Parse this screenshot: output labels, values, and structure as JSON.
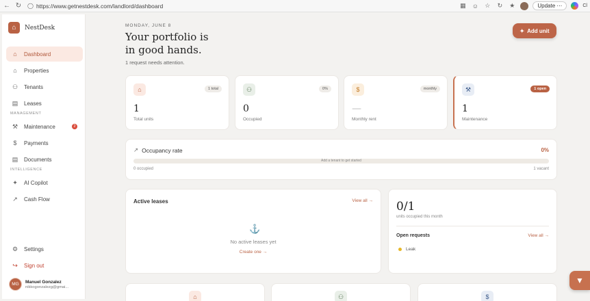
{
  "browser": {
    "url": "https://www.getnestdesk.com/landlord/dashboard",
    "update_label": "Update",
    "more_label": "⋯",
    "copilot_label": "Cl"
  },
  "sidebar": {
    "brand": "NestDesk",
    "items": [
      {
        "label": "Dashboard",
        "icon": "home-icon"
      },
      {
        "label": "Properties",
        "icon": "building-icon"
      },
      {
        "label": "Tenants",
        "icon": "users-icon"
      },
      {
        "label": "Leases",
        "icon": "document-icon"
      }
    ],
    "section_management": "MANAGEMENT",
    "management_items": [
      {
        "label": "Maintenance",
        "icon": "wrench-icon",
        "badge": "2"
      },
      {
        "label": "Payments",
        "icon": "dollar-icon"
      },
      {
        "label": "Documents",
        "icon": "file-icon"
      }
    ],
    "section_intelligence": "INTELLIGENCE",
    "intelligence_items": [
      {
        "label": "AI Copilot",
        "icon": "sparkle-icon"
      },
      {
        "label": "Cash Flow",
        "icon": "trend-icon"
      }
    ],
    "settings_label": "Settings",
    "signout_label": "Sign out",
    "user": {
      "initials": "MG",
      "name": "Manuel Gonzalez",
      "email": "nikkogonzalezg@gmai..."
    }
  },
  "header": {
    "date": "MONDAY, JUNE 8",
    "headline_1": "Your portfolio is",
    "headline_2": "in good hands.",
    "subline": "1 request needs attention.",
    "add_unit_label": "Add unit"
  },
  "stats": [
    {
      "value": "1",
      "label": "Total units",
      "badge": "1 total",
      "icon": "home-icon"
    },
    {
      "value": "0",
      "label": "Occupied",
      "badge": "0%",
      "icon": "users-icon"
    },
    {
      "value": "—",
      "label": "Monthly rent",
      "badge": "monthly",
      "icon": "dollar-icon"
    },
    {
      "value": "1",
      "label": "Maintenance",
      "badge": "1 open",
      "icon": "wrench-icon"
    }
  ],
  "occupancy": {
    "title": "Occupancy rate",
    "percent": "0%",
    "fill_fraction": 0,
    "bar_hint": "Add a tenant to get started",
    "occupied_text": "0 occupied",
    "vacant_text": "1 vacant"
  },
  "leases": {
    "title": "Active leases",
    "view_all": "View all →",
    "empty_text": "No active leases yet",
    "create_link": "Create one →"
  },
  "occupancy_summary": {
    "fraction": "0/1",
    "subtitle": "units occupied this month",
    "requests_title": "Open requests",
    "view_all": "View all →",
    "request_item": "Leak"
  },
  "colors": {
    "accent": "#b96244",
    "danger": "#c0412f",
    "background": "#f3f2f0"
  }
}
